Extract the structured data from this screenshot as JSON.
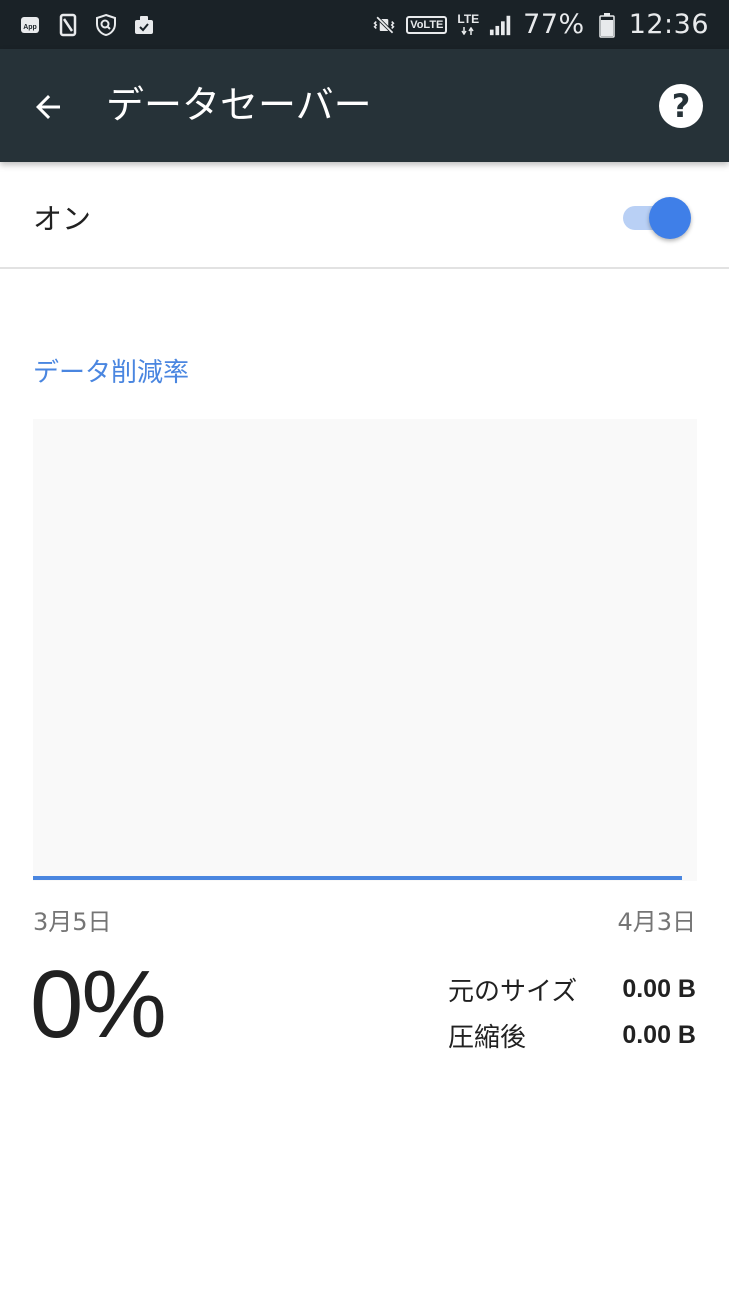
{
  "status_bar": {
    "icons_left": [
      "app-notification-icon",
      "phone-outline-icon",
      "shield-search-icon",
      "clipboard-check-icon"
    ],
    "icons_right": [
      "vibrate-mute-icon",
      "volte-icon",
      "lte-icon",
      "signal-icon",
      "battery-icon"
    ],
    "volte_label": "VoLTE",
    "lte_label": "LTE",
    "battery_percent": "77%",
    "time": "12:36"
  },
  "app_bar": {
    "title": "データセーバー",
    "back_icon": "arrow-back-icon",
    "help_icon": "help-icon",
    "help_glyph": "?"
  },
  "toggle": {
    "label": "オン",
    "state": true,
    "colors": {
      "track": "#b9d0f5",
      "thumb": "#3f7fe8"
    }
  },
  "savings_section": {
    "title": "データ削減率"
  },
  "chart_data": {
    "type": "line",
    "x": [
      "3月5日",
      "4月3日"
    ],
    "values": [
      0,
      0
    ],
    "x_start_label": "3月5日",
    "x_end_label": "4月3日",
    "line_color": "#4a86e0",
    "background_color": "#f9f9f9"
  },
  "summary": {
    "percent": "0%",
    "original_size_label": "元のサイズ",
    "original_size_value": "0.00 B",
    "compressed_label": "圧縮後",
    "compressed_value": "0.00 B"
  },
  "colors": {
    "status_bar_bg": "#1a2227",
    "app_bar_bg": "#263238",
    "accent": "#4a86e0"
  }
}
